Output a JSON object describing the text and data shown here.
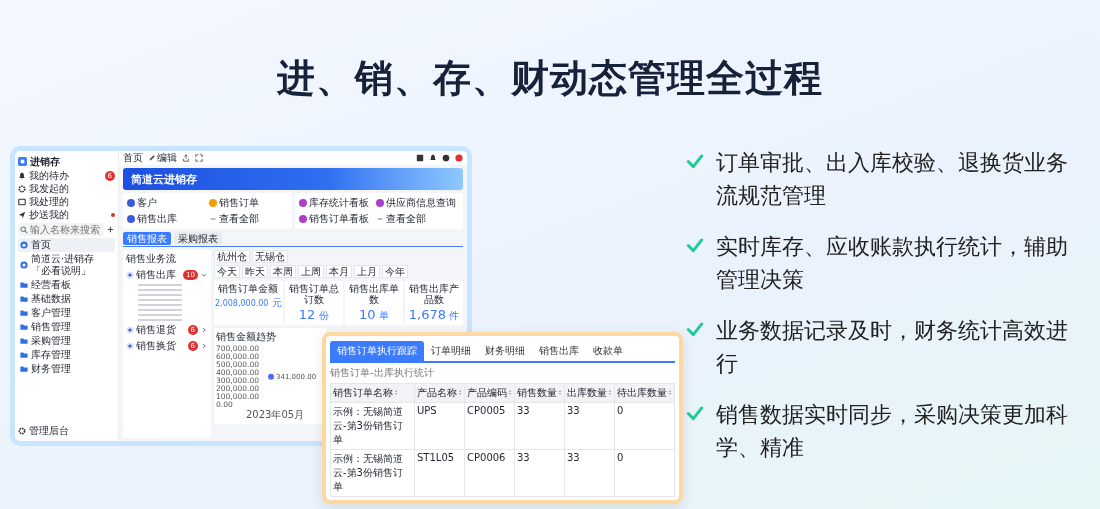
{
  "title": "进、销、存、财动态管理全过程",
  "features": [
    {
      "text": "订单审批、出入库校验、退换货业务流规范管理"
    },
    {
      "text": "实时库存、应收账款执行统计，辅助管理决策"
    },
    {
      "text": "业务数据记录及时，财务统计高效进行"
    },
    {
      "text": "销售数据实时同步，采购决策更加科学、精准"
    }
  ],
  "app": {
    "name": "进销存",
    "todo": [
      {
        "label": "我的待办",
        "kind": "bell",
        "badge": "6"
      },
      {
        "label": "我发起的",
        "kind": "gear"
      },
      {
        "label": "我处理的",
        "kind": "box"
      },
      {
        "label": "抄送我的",
        "kind": "send",
        "dot": true
      }
    ],
    "search": {
      "placeholder": "输入名称来搜索"
    },
    "nav": [
      {
        "label": "首页",
        "kind": "home",
        "selected": true
      },
      {
        "label": "简道云·进销存「必看说明」",
        "kind": "doc",
        "selected": false
      },
      {
        "label": "经营看板",
        "kind": "folder",
        "selected": false
      },
      {
        "label": "基础数据",
        "kind": "folder",
        "selected": false
      },
      {
        "label": "客户管理",
        "kind": "folder",
        "selected": false
      },
      {
        "label": "销售管理",
        "kind": "folder",
        "selected": false
      },
      {
        "label": "采购管理",
        "kind": "folder",
        "selected": false
      },
      {
        "label": "库存管理",
        "kind": "folder",
        "selected": false
      },
      {
        "label": "财务管理",
        "kind": "folder",
        "selected": false
      }
    ],
    "admin": "管理后台",
    "toolbar": [
      "首页",
      "编辑"
    ],
    "banner": "简道云进销存",
    "shortcut_groups": [
      [
        {
          "label": "客户",
          "kind": "shortcut",
          "color": "#3b5bdb"
        },
        {
          "label": "销售订单",
          "kind": "shortcut",
          "color": "#f59f00"
        },
        {
          "label": "销售出库",
          "kind": "shortcut",
          "color": "#3b5bdb"
        },
        {
          "label": "查看全部",
          "kind": "more"
        }
      ],
      [
        {
          "label": "库存统计看板",
          "kind": "shortcut",
          "color": "#ae3ec9"
        },
        {
          "label": "供应商信息查询",
          "kind": "shortcut",
          "color": "#ae3ec9"
        },
        {
          "label": "销售订单看板",
          "kind": "shortcut",
          "color": "#ae3ec9"
        },
        {
          "label": "查看全部",
          "kind": "more"
        }
      ]
    ],
    "report_tabs": [
      {
        "label": "销售报表",
        "selected": true
      },
      {
        "label": "采购报表",
        "selected": false
      }
    ],
    "flow": {
      "title": "销售业务流",
      "items": [
        {
          "label": "销售出库",
          "badge": "10",
          "expanded": true
        },
        {
          "label": "销售退货",
          "badge": "6",
          "expanded": false
        },
        {
          "label": "销售换货",
          "badge": "6",
          "expanded": false
        }
      ]
    },
    "warehouses": [
      "杭州仓",
      "无锡仓"
    ],
    "periods": [
      "今天",
      "昨天",
      "本周",
      "上周",
      "本月",
      "上月",
      "今年"
    ],
    "stats": [
      {
        "label": "销售订单金额",
        "value": "2,008,000.00",
        "unit": "元"
      },
      {
        "label": "销售订单总订数",
        "value": "12",
        "unit": "份"
      },
      {
        "label": "销售出库单数",
        "value": "10",
        "unit": "单"
      },
      {
        "label": "销售出库产品数",
        "value": "1,678",
        "unit": "件"
      }
    ],
    "trend": {
      "title": "销售金额趋势",
      "chart_data": {
        "type": "scatter",
        "categories": [
          "2023年05月"
        ],
        "series": [
          {
            "color": "#4c6ef5",
            "values": [
              341000
            ]
          }
        ],
        "ylim": [
          0,
          700000
        ],
        "yticks": [
          {
            "value": 700000,
            "label": "700,000.00"
          },
          {
            "value": 600000,
            "label": "600,000.00"
          },
          {
            "value": 500000,
            "label": "500,000.00"
          },
          {
            "value": 400000,
            "label": "400,000.00"
          },
          {
            "value": 300000,
            "label": "300,000.00"
          },
          {
            "value": 200000,
            "label": "200,000.00"
          },
          {
            "value": 100000,
            "label": "100,000.00"
          },
          {
            "value": 0,
            "label": "0.00"
          }
        ],
        "value_labels": [
          "341,000.00"
        ]
      }
    }
  },
  "detail": {
    "tabs": [
      {
        "label": "销售订单执行跟踪",
        "selected": true
      },
      {
        "label": "订单明细",
        "selected": false
      },
      {
        "label": "财务明细",
        "selected": false
      },
      {
        "label": "销售出库",
        "selected": false
      },
      {
        "label": "收款单",
        "selected": false
      }
    ],
    "subtitle": "销售订单-出库执行统计",
    "columns": [
      "销售订单名称",
      "产品名称",
      "产品编码",
      "销售数量",
      "出库数量",
      "待出库数量"
    ],
    "rows": [
      [
        "示例：无锡简道云-第3份销售订单",
        "UPS",
        "CP0005",
        "33",
        "33",
        "0"
      ],
      [
        "示例：无锡简道云-第3份销售订单",
        "ST1L05",
        "CP0006",
        "33",
        "33",
        "0"
      ]
    ]
  }
}
